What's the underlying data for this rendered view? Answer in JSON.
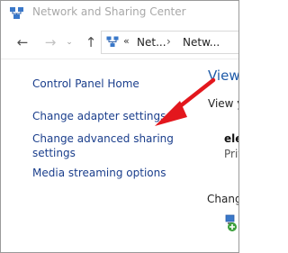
{
  "window": {
    "title": "Network and Sharing Center"
  },
  "address_bar": {
    "prefix": "«",
    "crumb1": "Net...",
    "separator": "›",
    "crumb2": "Netw..."
  },
  "nav": {
    "back_icon": "←",
    "forward_icon": "→",
    "recent_icon": "⌄",
    "up_icon": "↑"
  },
  "task_pane": {
    "links": [
      "Control Panel Home",
      "Change adapter settings",
      "Change advanced sharing",
      "settings",
      "Media streaming options"
    ]
  },
  "content": {
    "heading": "View",
    "view_text": "View yo",
    "network_name": "ele",
    "network_type": "Priv",
    "change_text": "Change"
  },
  "annotation": {
    "arrow_color": "#e3171d"
  }
}
